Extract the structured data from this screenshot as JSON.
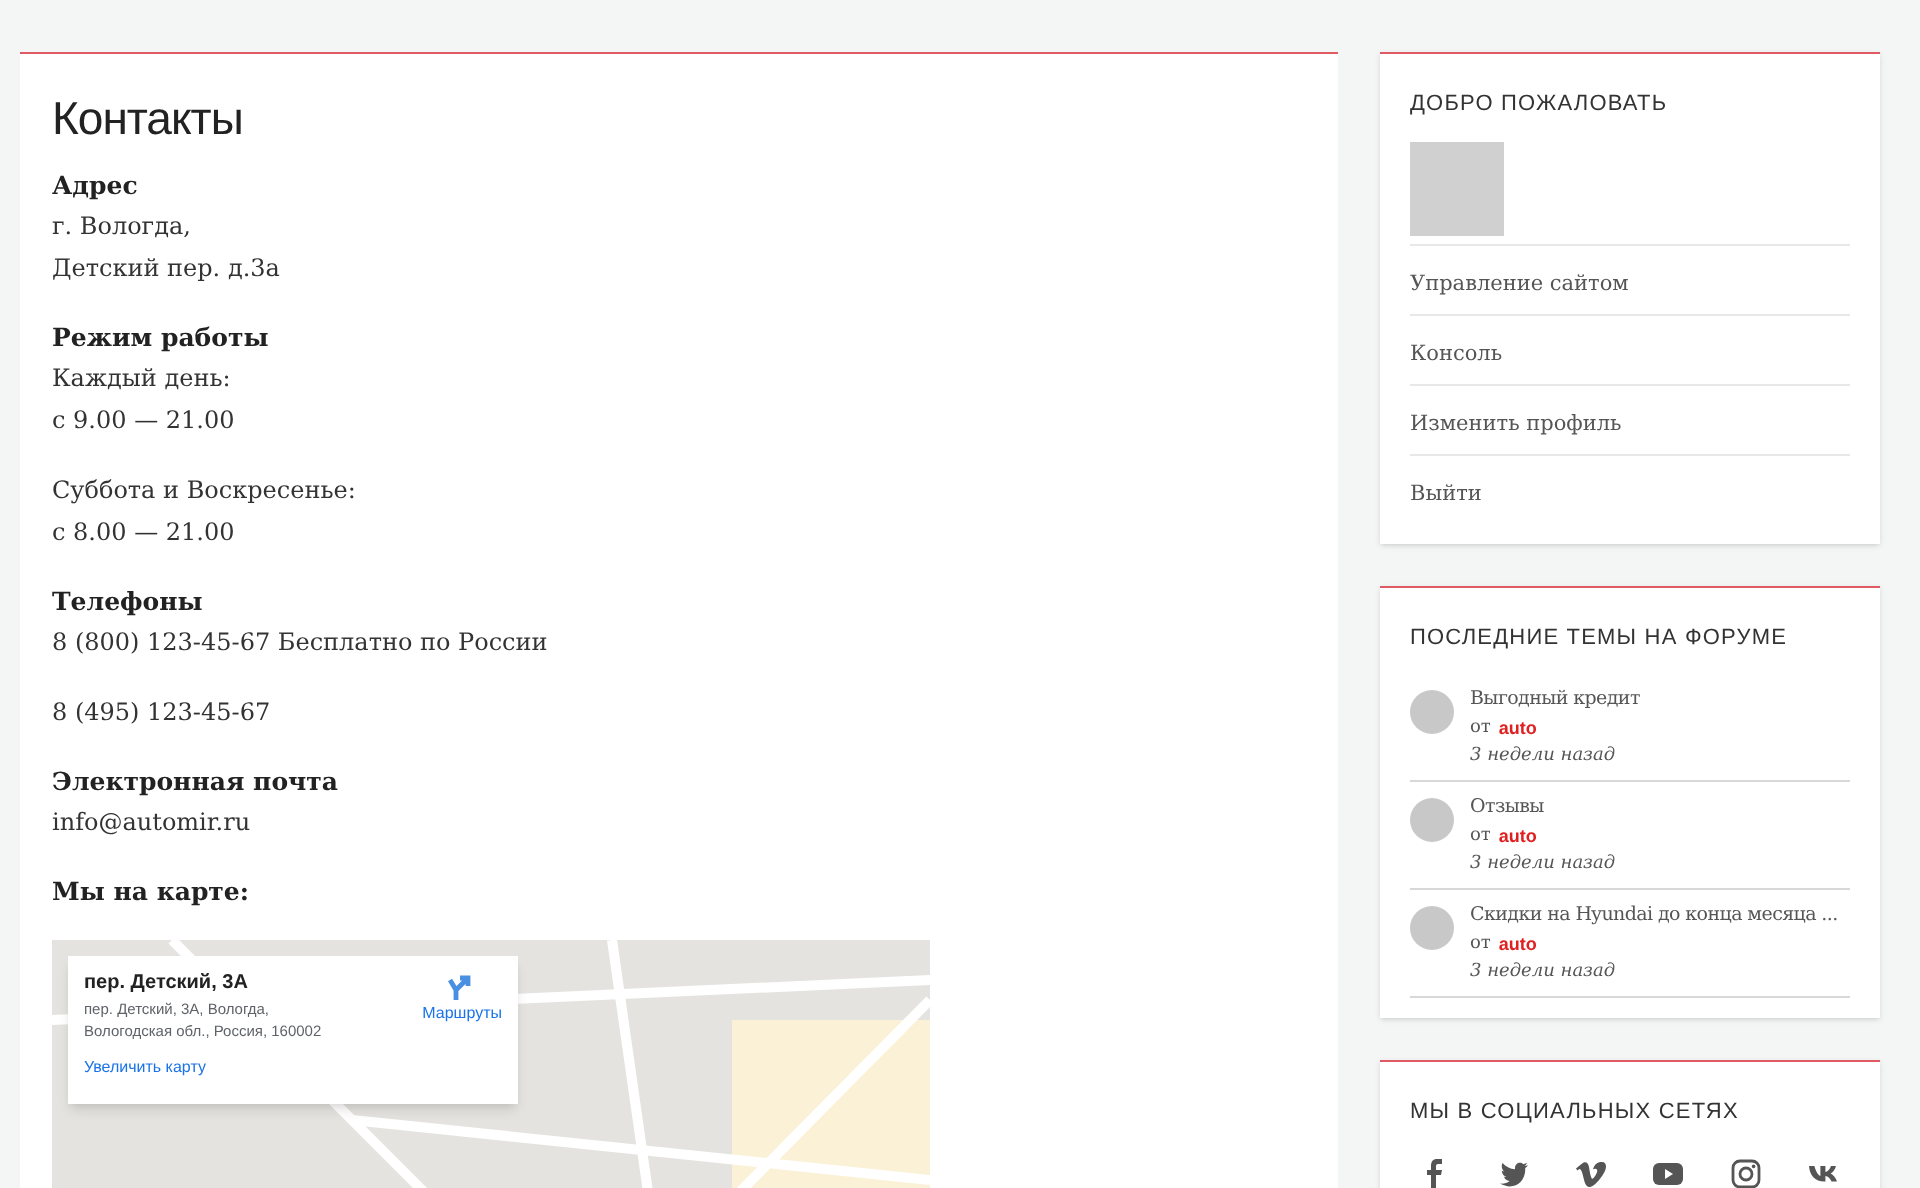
{
  "page_title": "Контакты",
  "sections": [
    {
      "heading": "Адрес",
      "paragraphs": [
        [
          "г. Вологда,",
          "Детский пер. д.3а"
        ]
      ]
    },
    {
      "heading": "Режим работы",
      "paragraphs": [
        [
          "Каждый день:",
          "с 9.00 — 21.00"
        ],
        [
          "Суббота и Воскресенье:",
          "с 8.00 — 21.00"
        ]
      ]
    },
    {
      "heading": "Телефоны",
      "paragraphs": [
        [
          "8 (800) 123-45-67 Бесплатно по России"
        ],
        [
          "8 (495) 123-45-67"
        ]
      ]
    },
    {
      "heading": "Электронная почта",
      "paragraphs": [
        [
          "info@automir.ru"
        ]
      ]
    },
    {
      "heading": "Мы на карте:"
    }
  ],
  "map": {
    "place_title": "пер. Детский, 3А",
    "address_lines": [
      "пер. Детский, 3А, Вологда,",
      "Вологодская обл., Россия, 160002"
    ],
    "directions": "Маршруты",
    "enlarge": "Увеличить карту"
  },
  "sidebar": {
    "welcome": {
      "title": "ДОБРО ПОЖАЛОВАТЬ",
      "links": [
        "Управление сайтом",
        "Консоль",
        "Изменить профиль",
        "Выйти"
      ]
    },
    "forum": {
      "title": "ПОСЛЕДНИЕ ТЕМЫ НА ФОРУМЕ",
      "topics": [
        {
          "title": "Выгодный кредит",
          "by_label": "от",
          "author": "auto",
          "time": "3 недели назад"
        },
        {
          "title": "Отзывы",
          "by_label": "от",
          "author": "auto",
          "time": "3 недели назад"
        },
        {
          "title": "Скидки на Hyundai до конца месяца ...",
          "by_label": "от",
          "author": "auto",
          "time": "3 недели назад"
        }
      ]
    },
    "social": {
      "title": "МЫ В СОЦИАЛЬНЫХ СЕТЯХ",
      "icons": [
        {
          "kind": "facebook"
        },
        {
          "kind": "twitter"
        },
        {
          "kind": "vimeo"
        },
        {
          "kind": "youtube"
        },
        {
          "kind": "instagram"
        },
        {
          "kind": "vk"
        }
      ]
    }
  }
}
